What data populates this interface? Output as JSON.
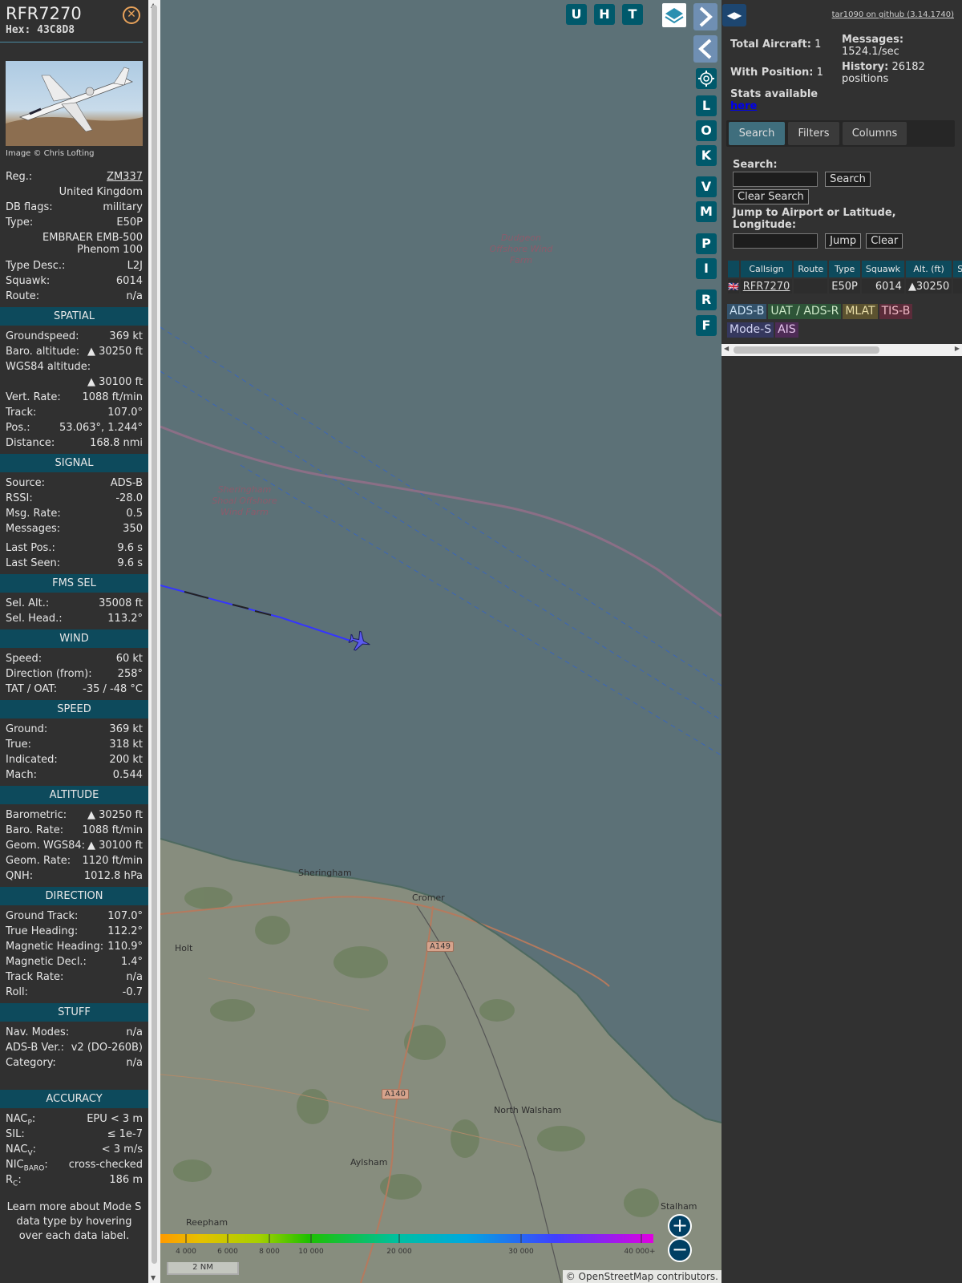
{
  "info": {
    "callsign": "RFR7270",
    "hex": "Hex: 43C8D8",
    "image_credit": "Image © Chris Lofting",
    "reg_label": "Reg.:",
    "reg": "ZM337",
    "country": "United Kingdom",
    "dbflags_label": "DB flags:",
    "dbflags": "military",
    "type_label": "Type:",
    "type": "E50P",
    "type_full": "EMBRAER EMB-500 Phenom 100",
    "typedesc_label": "Type Desc.:",
    "typedesc": "L2J",
    "squawk_label": "Squawk:",
    "squawk": "6014",
    "route_label": "Route:",
    "route": "n/a"
  },
  "sections": {
    "spatial": "SPATIAL",
    "signal": "SIGNAL",
    "fms": "FMS SEL",
    "wind": "WIND",
    "speed": "SPEED",
    "altitude": "ALTITUDE",
    "direction": "DIRECTION",
    "stuff": "STUFF",
    "accuracy": "ACCURACY"
  },
  "spatial": [
    {
      "k": "Groundspeed:",
      "v": "369 kt"
    },
    {
      "k": "Baro. altitude:",
      "v": "▲ 30250 ft"
    },
    {
      "k": "WGS84 altitude:",
      "v": ""
    },
    {
      "k": "",
      "v": "▲ 30100 ft"
    },
    {
      "k": "Vert. Rate:",
      "v": "1088 ft/min"
    },
    {
      "k": "Track:",
      "v": "107.0°"
    },
    {
      "k": "Pos.:",
      "v": "53.063°, 1.244°"
    },
    {
      "k": "Distance:",
      "v": "168.8 nmi"
    }
  ],
  "signal": [
    {
      "k": "Source:",
      "v": "ADS-B"
    },
    {
      "k": "RSSI:",
      "v": "-28.0"
    },
    {
      "k": "Msg. Rate:",
      "v": "0.5"
    },
    {
      "k": "Messages:",
      "v": "350"
    },
    {
      "k": "Last Pos.:",
      "v": "9.6 s"
    },
    {
      "k": "Last Seen:",
      "v": "9.6 s"
    }
  ],
  "fms": [
    {
      "k": "Sel. Alt.:",
      "v": "35008 ft"
    },
    {
      "k": "Sel. Head.:",
      "v": "113.2°"
    }
  ],
  "wind": [
    {
      "k": "Speed:",
      "v": "60 kt"
    },
    {
      "k": "Direction (from):",
      "v": "258°"
    },
    {
      "k": "TAT / OAT:",
      "v": "-35 / -48 °C"
    }
  ],
  "speed": [
    {
      "k": "Ground:",
      "v": "369 kt"
    },
    {
      "k": "True:",
      "v": "318 kt"
    },
    {
      "k": "Indicated:",
      "v": "200 kt"
    },
    {
      "k": "Mach:",
      "v": "0.544"
    }
  ],
  "altitude": [
    {
      "k": "Barometric:",
      "v": "▲ 30250 ft"
    },
    {
      "k": "Baro. Rate:",
      "v": "1088 ft/min"
    },
    {
      "k": "Geom. WGS84:",
      "v": "▲ 30100 ft"
    },
    {
      "k": "Geom. Rate:",
      "v": "1120 ft/min"
    },
    {
      "k": "QNH:",
      "v": "1012.8 hPa"
    }
  ],
  "direction": [
    {
      "k": "Ground Track:",
      "v": "107.0°"
    },
    {
      "k": "True Heading:",
      "v": "112.2°"
    },
    {
      "k": "Magnetic Heading:",
      "v": "110.9°"
    },
    {
      "k": "Magnetic Decl.:",
      "v": "1.4°"
    },
    {
      "k": "Track Rate:",
      "v": "n/a"
    },
    {
      "k": "Roll:",
      "v": "-0.7"
    }
  ],
  "stuff": [
    {
      "k": "Nav. Modes:",
      "v": "n/a"
    },
    {
      "k": "ADS-B Ver.:",
      "v": "v2 (DO-260B)"
    },
    {
      "k": "Category:",
      "v": "n/a"
    }
  ],
  "accuracy": [
    {
      "k": "NAC",
      "sub": "P",
      "v": "EPU < 3 m"
    },
    {
      "k": "SIL:",
      "sub": "",
      "v": "≤ 1e-7"
    },
    {
      "k": "NAC",
      "sub": "V",
      "v": "< 3 m/s"
    },
    {
      "k": "NIC",
      "sub": "BARO",
      "v": "cross-checked"
    },
    {
      "k": "R",
      "sub": "C",
      "v": "186 m"
    }
  ],
  "learn_more": "Learn more about Mode S data type by hovering over each data label.",
  "map": {
    "buttons": [
      "U",
      "H",
      "T"
    ],
    "side_buttons": [
      "L",
      "O",
      "K",
      "V",
      "M",
      "P",
      "I",
      "R",
      "F"
    ],
    "labels": {
      "dudgeon": "Dudgeon Offshore Wind Farm",
      "sheringham_shoal": "Sheringham Shoal Offshore Wind Farm"
    },
    "towns": [
      "Sheringham",
      "Cromer",
      "Holt",
      "North Walsham",
      "Aylsham",
      "Reepham",
      "Stalham"
    ],
    "roads": [
      "A149",
      "A140"
    ],
    "altitude_scale": [
      "4 000",
      "6 000",
      "8 000",
      "10 000",
      "20 000",
      "30 000",
      "40 000+"
    ],
    "scale_bar": "2 NM",
    "attribution_prefix": "© ",
    "attribution_link": "OpenStreetMap",
    "attribution_suffix": " contributors."
  },
  "sidebar": {
    "github": "tar1090 on github (3.14.1740)",
    "total_aircraft_label": "Total Aircraft:",
    "total_aircraft": "1",
    "with_position_label": "With Position:",
    "with_position": "1",
    "messages_label": "Messages:",
    "messages": "1524.1/sec",
    "history_label": "History:",
    "history": "26182 positions",
    "stats_label": "Stats available",
    "stats_link": "here",
    "tabs": [
      "Search",
      "Filters",
      "Columns"
    ],
    "search_label": "Search:",
    "search_button": "Search",
    "clear_search_button": "Clear Search",
    "jump_label": "Jump to Airport or Latitude, Longitude:",
    "jump_button": "Jump",
    "clear_button": "Clear",
    "table_headers": [
      "",
      "Callsign",
      "Route",
      "Type",
      "Squawk",
      "Alt. (ft)",
      "Sp"
    ],
    "table_rows": [
      {
        "flag": "🇬🇧",
        "callsign": "RFR7270",
        "route": "",
        "type": "E50P",
        "squawk": "6014",
        "alt": "▲30250"
      }
    ],
    "legend": [
      "ADS-B",
      "UAT / ADS-R",
      "MLAT",
      "TIS-B",
      "Mode-S",
      "AIS"
    ]
  },
  "colors": {
    "section_bg": "#0d4a5c",
    "aircraft": "#4a4ae6",
    "sea": "#5c7177"
  }
}
